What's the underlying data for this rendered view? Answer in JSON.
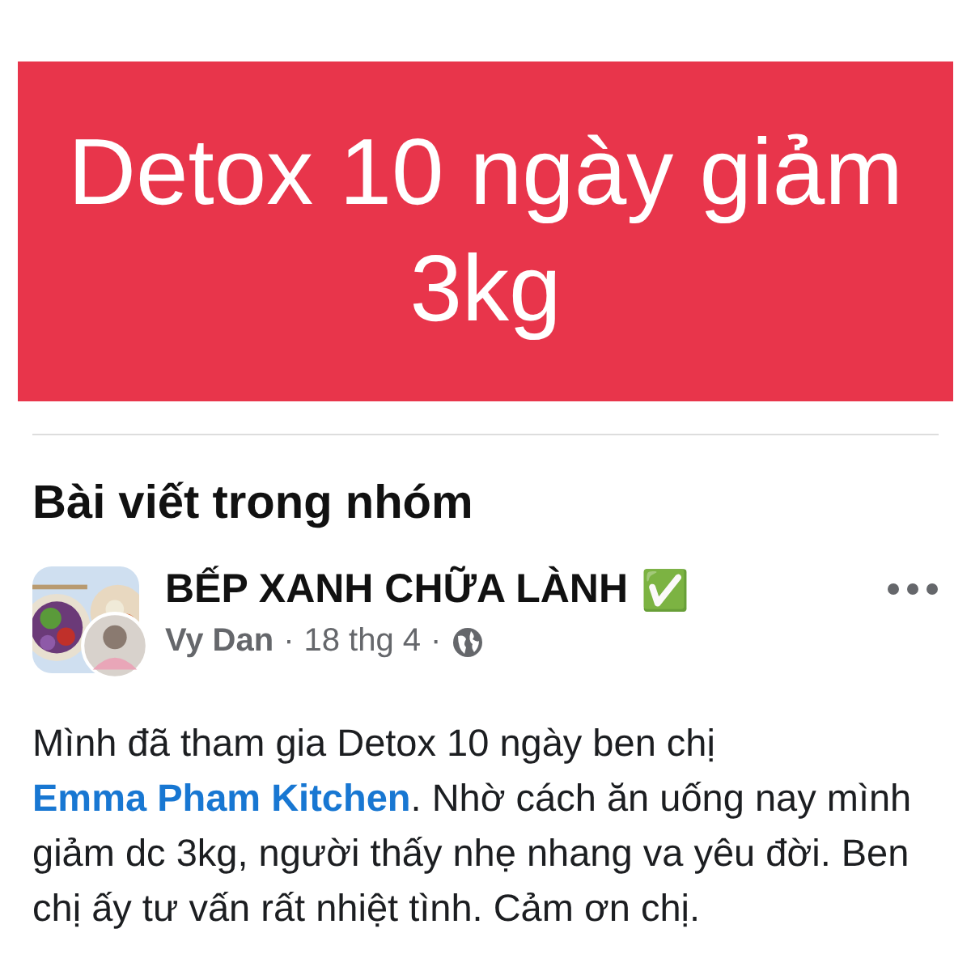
{
  "banner": {
    "title": "Detox 10 ngày giảm 3kg"
  },
  "section": {
    "title": "Bài viết trong nhóm"
  },
  "post": {
    "group": "BẾP XANH CHỮA LÀNH",
    "group_badge": "✅",
    "author": "Vy Dan",
    "separator_1": "·",
    "date": "18 thg 4",
    "separator_2": "·",
    "body": "Mình đã tham gia Detox 10 ngày ben chị ",
    "link": "Emma Pham Kitchen",
    "body_rest": ". Nhờ cách ăn uống nay mình giảm dc 3kg, người thấy nhẹ nhang va yêu đời. Ben chị ấy tư vấn rất nhiệt tình. Cảm ơn chị."
  }
}
